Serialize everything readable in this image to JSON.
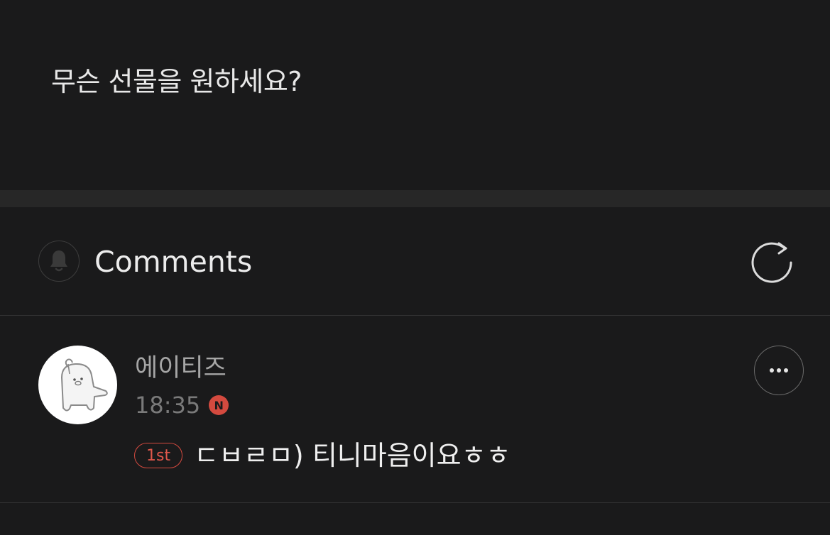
{
  "post": {
    "question": "무슨 선물을 원하세요?"
  },
  "comments_section": {
    "title": "Comments",
    "bell_icon": "bell-icon",
    "refresh_icon": "refresh-icon"
  },
  "comments": [
    {
      "author": "에이티즈",
      "time": "18:35",
      "new_badge": "N",
      "rank": "1st",
      "text": "ㄷㅂㄹㅁ) 티니마음이요ㅎㅎ",
      "more_icon": "more-horizontal-icon"
    }
  ],
  "colors": {
    "background": "#1a1a1b",
    "divider_band": "#272727",
    "accent_red": "#d44a3f"
  }
}
